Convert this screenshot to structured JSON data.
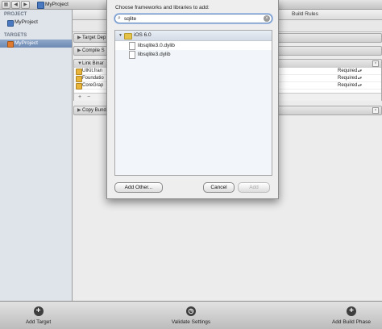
{
  "navbar": {
    "back": "◀",
    "forward": "▶",
    "breadcrumb": "MyProject"
  },
  "sidebar": {
    "project_header": "PROJECT",
    "project_item": "MyProject",
    "targets_header": "TARGETS",
    "target_item": "MyProject"
  },
  "editor": {
    "tab_build_rules": "Build Rules",
    "phases": {
      "target_dependencies": "Target Dep",
      "compile_sources": "Compile S",
      "link_binary": "Link Binar",
      "copy_bundle": "Copy Bund"
    },
    "frameworks": [
      {
        "name": "UIKit.fran",
        "status": "Required"
      },
      {
        "name": "Foundatio",
        "status": "Required"
      },
      {
        "name": "CoreGrap",
        "status": "Required"
      }
    ],
    "footer_add": "+",
    "footer_remove": "−"
  },
  "sheet": {
    "title": "Choose frameworks and libraries to add:",
    "search": {
      "value": "sqlite",
      "placeholder": ""
    },
    "group_label": "iOS 6.0",
    "libraries": [
      "libsqlite3.0.dylib",
      "libsqlite3.dylib"
    ],
    "add_other_label": "Add Other...",
    "cancel_label": "Cancel",
    "add_label": "Add"
  },
  "bottombar": {
    "add_target_label": "Add Target",
    "validate_label": "Validate Settings",
    "add_phase_label": "Add Build Phase"
  },
  "colors": {
    "selection": "#6d8ab4",
    "search_focus": "#6c8fbf",
    "folder": "#e5c248"
  }
}
